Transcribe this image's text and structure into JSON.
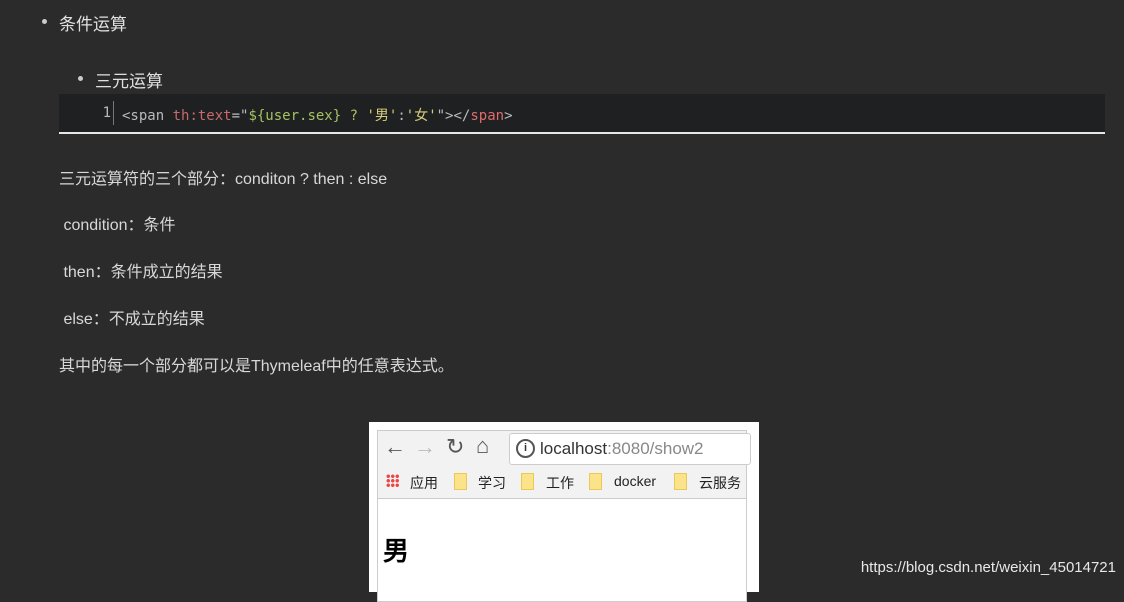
{
  "list": {
    "item1": "条件运算",
    "item2": "三元运算"
  },
  "code": {
    "line_number": "1",
    "tag_open": "<span",
    "attr": " th:text",
    "eq": "=\"",
    "expr": "${user.sex} ? ",
    "q1": "'男'",
    ":": ":",
    "q2": "'女'",
    "close": "\"></",
    "tag_close": "span",
    ">": ">"
  },
  "paragraphs": [
    "三元运算符的三个部分：conditon ? then : else",
    " condition：条件",
    " then：条件成立的结果",
    " else：不成立的结果",
    "其中的每一个部分都可以是Thymeleaf中的任意表达式。"
  ],
  "browser": {
    "url_host": "localhost",
    "url_rest": ":8080/show2",
    "bookmarks": [
      "应用",
      "学习",
      "工作",
      "docker",
      "云服务"
    ],
    "content": "男"
  },
  "watermark": "https://blog.csdn.net/weixin_45014721"
}
